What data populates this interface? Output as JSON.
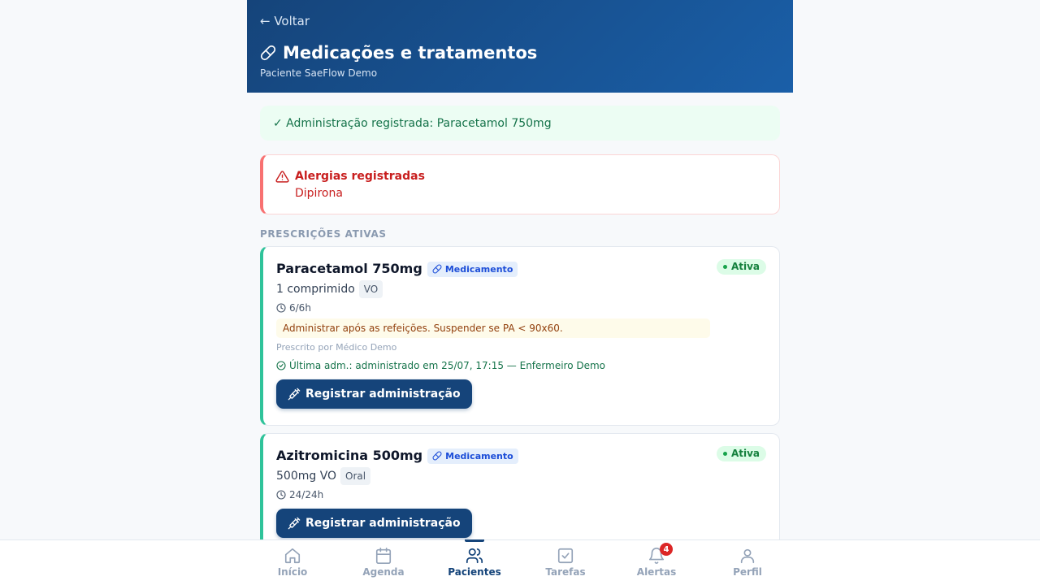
{
  "header": {
    "back_label": "← Voltar",
    "title": "Medicações e tratamentos",
    "subtitle": "Paciente SaeFlow Demo"
  },
  "success_message": "✓ Administração registrada: Paracetamol 750mg",
  "allergies": {
    "title": "Alergias registradas",
    "value": "Dipirona"
  },
  "section_title": "PRESCRIÇÕES ATIVAS",
  "prescriptions": [
    {
      "name": "Paracetamol 750mg",
      "type_label": "Medicamento",
      "status": "Ativa",
      "dose": "1 comprimido",
      "route": "VO",
      "frequency": "6/6h",
      "note": "Administrar após as refeições. Suspender se PA < 90x60.",
      "prescriber": "Prescrito por Médico Demo",
      "last_administration": "Última adm.: administrado em 25/07, 17:15 — Enfermeiro Demo",
      "action_label": "Registrar administração"
    },
    {
      "name": "Azitromicina 500mg",
      "type_label": "Medicamento",
      "status": "Ativa",
      "dose": "500mg VO",
      "route": "Oral",
      "frequency": "24/24h",
      "action_label": "Registrar administração"
    }
  ],
  "nav": {
    "items": [
      {
        "label": "Início",
        "icon": "home-icon"
      },
      {
        "label": "Agenda",
        "icon": "calendar-icon"
      },
      {
        "label": "Pacientes",
        "icon": "users-icon",
        "active": true
      },
      {
        "label": "Tarefas",
        "icon": "check-square-icon"
      },
      {
        "label": "Alertas",
        "icon": "bell-icon",
        "badge": "4"
      },
      {
        "label": "Perfil",
        "icon": "user-icon"
      }
    ]
  },
  "colors": {
    "primary": "#15447a",
    "success": "#15734a",
    "danger": "#c81e1e",
    "active_border": "#2fc39a"
  }
}
